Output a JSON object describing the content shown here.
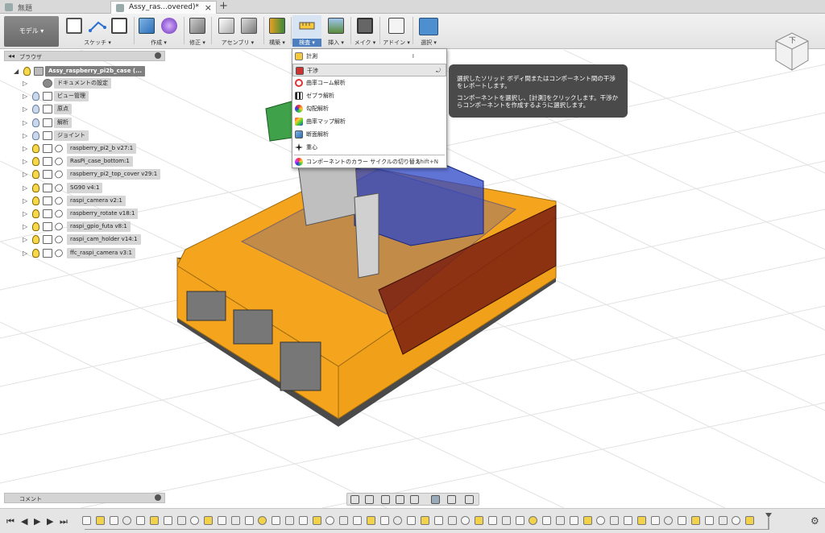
{
  "tabs": [
    {
      "label": "無題"
    },
    {
      "label": "Assy_ras...overed)*"
    }
  ],
  "toolbar": {
    "workspace": "モデル ▾",
    "groups": [
      {
        "label": "スケッチ ▾"
      },
      {
        "label": "作成 ▾"
      },
      {
        "label": "修正 ▾"
      },
      {
        "label": "アセンブリ ▾"
      },
      {
        "label": "構築 ▾"
      },
      {
        "label": "検査 ▾"
      },
      {
        "label": "挿入 ▾"
      },
      {
        "label": "メイク ▾"
      },
      {
        "label": "アドイン ▾"
      },
      {
        "label": "選択 ▾"
      }
    ]
  },
  "viewcube": {
    "face": "下"
  },
  "browser": {
    "title": "ブラウザ",
    "root": "Assy_raspberry_pi2b_case (...",
    "items": [
      {
        "label": "ドキュメントの設定"
      },
      {
        "label": "ビュー管理"
      },
      {
        "label": "原点"
      },
      {
        "label": "解析"
      },
      {
        "label": "ジョイント"
      },
      {
        "label": "raspberry_pi2_b v27:1"
      },
      {
        "label": "RasPi_case_bottom:1"
      },
      {
        "label": "raspberry_pi2_top_cover v29:1"
      },
      {
        "label": "SG90 v4:1"
      },
      {
        "label": "raspi_camera v2:1"
      },
      {
        "label": "raspberry_rotate v18:1"
      },
      {
        "label": "raspi_gpio_futa v8:1"
      },
      {
        "label": "raspi_cam_holder v14:1"
      },
      {
        "label": "ffc_raspi_camera v3:1"
      }
    ]
  },
  "comments": {
    "label": "コメント"
  },
  "inspect_menu": {
    "items": [
      {
        "label": "計測",
        "shortcut": "I"
      },
      {
        "label": "干渉",
        "shortcut": ""
      },
      {
        "label": "曲率コーム解析",
        "shortcut": ""
      },
      {
        "label": "ゼブラ解析",
        "shortcut": ""
      },
      {
        "label": "勾配解析",
        "shortcut": ""
      },
      {
        "label": "曲率マップ解析",
        "shortcut": ""
      },
      {
        "label": "断面解析",
        "shortcut": ""
      },
      {
        "label": "重心",
        "shortcut": ""
      },
      {
        "label": "コンポーネントのカラー サイクルの切り替え",
        "shortcut": "Shift+N"
      }
    ]
  },
  "tooltip": {
    "line1": "選択したソリッド ボディ間またはコンポーネント間の干渉をレポートします。",
    "line2": "コンポーネントを選択し、[計測]をクリックします。干渉からコンポーネントを作成するように選択します。"
  },
  "colors": {
    "case_orange": "#f5a41e",
    "case_dark": "#4a4a4a",
    "board_blue": "#2b45c8",
    "gpio_red": "#7a1e10",
    "accent_blue": "#4d7fc0"
  }
}
